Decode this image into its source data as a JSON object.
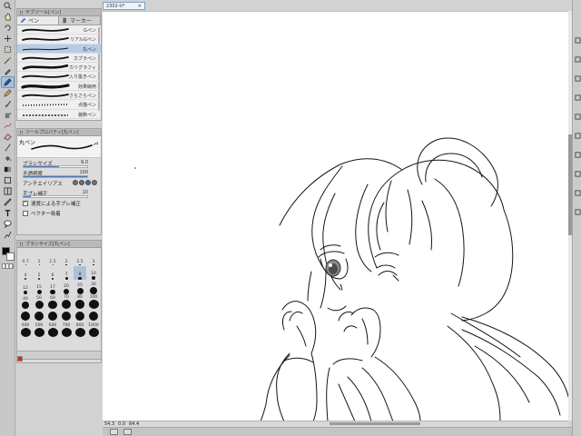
{
  "toolbar": {
    "tools": [
      {
        "name": "zoom-tool-icon",
        "shape": "zoom"
      },
      {
        "name": "hand-tool-icon",
        "shape": "hand"
      },
      {
        "name": "rotate-tool-icon",
        "shape": "rotate"
      },
      {
        "name": "move-tool-icon",
        "shape": "move"
      },
      {
        "name": "select-rect-tool-icon",
        "shape": "rect"
      },
      {
        "name": "magic-wand-tool-icon",
        "shape": "wand"
      },
      {
        "name": "eyedropper-tool-icon",
        "shape": "dropper"
      },
      {
        "name": "pen-tool-icon",
        "shape": "pen",
        "active": true
      },
      {
        "name": "pencil-tool-icon",
        "shape": "pencil"
      },
      {
        "name": "brush-tool-icon",
        "shape": "brush"
      },
      {
        "name": "airbrush-tool-icon",
        "shape": "air"
      },
      {
        "name": "decoration-tool-icon",
        "shape": "deco"
      },
      {
        "name": "eraser-tool-icon",
        "shape": "eraser"
      },
      {
        "name": "blend-tool-icon",
        "shape": "blend"
      },
      {
        "name": "fill-tool-icon",
        "shape": "fill"
      },
      {
        "name": "gradient-tool-icon",
        "shape": "grad"
      },
      {
        "name": "figure-tool-icon",
        "shape": "figure"
      },
      {
        "name": "frame-tool-icon",
        "shape": "frame"
      },
      {
        "name": "ruler-tool-icon",
        "shape": "ruler"
      },
      {
        "name": "text-tool-icon",
        "shape": "text"
      },
      {
        "name": "balloon-tool-icon",
        "shape": "balloon"
      },
      {
        "name": "correct-line-tool-icon",
        "shape": "correct"
      }
    ],
    "colors": {
      "main": "#0b0b0b",
      "sub": "#ffffff"
    }
  },
  "sub_tool": {
    "title": "サブツール[ペン]",
    "tabs": [
      {
        "label": "ペン",
        "active": true
      },
      {
        "label": "マーカー",
        "active": false
      }
    ],
    "brushes": [
      {
        "label": "Gペン",
        "stroke": "taper"
      },
      {
        "label": "リアルGペン",
        "stroke": "taper"
      },
      {
        "label": "丸ペン",
        "stroke": "thin",
        "selected": true
      },
      {
        "label": "カブラペン",
        "stroke": "taper"
      },
      {
        "label": "カリグラフィ",
        "stroke": "calli"
      },
      {
        "label": "入り抜きペン",
        "stroke": "taper"
      },
      {
        "label": "効果線用",
        "stroke": "bold"
      },
      {
        "label": "さらさらペン",
        "stroke": "taper"
      },
      {
        "label": "点描ペン",
        "stroke": "dots"
      },
      {
        "label": "装飾ペン",
        "stroke": "deco"
      }
    ]
  },
  "tool_property": {
    "title": "ツールプロパティ[丸ペン]",
    "preview_name": "丸ペン",
    "rows": [
      {
        "label": "ブラシサイズ",
        "value": "9.0",
        "fill": 0.55
      },
      {
        "label": "不透明度",
        "value": "100",
        "fill": 1.0
      },
      {
        "label": "アンチエイリアス",
        "aa": true
      },
      {
        "label": "手ブレ補正",
        "value": "10",
        "fill": 0.12
      },
      {
        "label": "速度による手ブレ補正",
        "checkbox": true,
        "checked": true
      },
      {
        "label": "ベクター吸着",
        "checkbox": true,
        "checked": false
      }
    ]
  },
  "brush_size": {
    "title": "ブラシサイズ[丸ペン]",
    "sizes": [
      {
        "label": "0.7",
        "d": 1
      },
      {
        "label": "1",
        "d": 1
      },
      {
        "label": "1.5",
        "d": 1
      },
      {
        "label": "2",
        "d": 1.5
      },
      {
        "label": "2.5",
        "d": 1.5
      },
      {
        "label": "3",
        "d": 1.5
      },
      {
        "label": "4",
        "d": 2
      },
      {
        "label": "5",
        "d": 2
      },
      {
        "label": "6",
        "d": 2.5
      },
      {
        "label": "7",
        "d": 3
      },
      {
        "label": "8",
        "d": 3.5,
        "sel": true
      },
      {
        "label": "10",
        "d": 4
      },
      {
        "label": "12",
        "d": 4.5
      },
      {
        "label": "15",
        "d": 5
      },
      {
        "label": "17",
        "d": 5.5
      },
      {
        "label": "20",
        "d": 6
      },
      {
        "label": "25",
        "d": 7
      },
      {
        "label": "30",
        "d": 8
      },
      {
        "label": "40",
        "d": 8.5
      },
      {
        "label": "50",
        "d": 9
      },
      {
        "label": "60",
        "d": 9.5
      },
      {
        "label": "70",
        "d": 10
      },
      {
        "label": "80",
        "d": 10.5
      },
      {
        "label": "100",
        "d": 11
      },
      {
        "label": "",
        "d": 10
      },
      {
        "label": "",
        "d": 10
      },
      {
        "label": "",
        "d": 10
      },
      {
        "label": "",
        "d": 10
      },
      {
        "label": "",
        "d": 10
      },
      {
        "label": "",
        "d": 10
      },
      {
        "label": "400",
        "d": 11
      },
      {
        "label": "500",
        "d": 11
      },
      {
        "label": "600",
        "d": 11
      },
      {
        "label": "700",
        "d": 11
      },
      {
        "label": "800",
        "d": 11
      },
      {
        "label": "1000",
        "d": 11
      }
    ]
  },
  "document": {
    "tab_title": "2302-ti*",
    "status_zoom": "54.3",
    "status_angle": "0.0",
    "status_pos": "64.4"
  },
  "right_strip": [
    "layer-icon",
    "navigator-icon",
    "history-icon",
    "material-icon",
    "info-icon",
    "color-icon",
    "flip-icon",
    "lock-icon",
    "settings-icon",
    "list-icon"
  ]
}
